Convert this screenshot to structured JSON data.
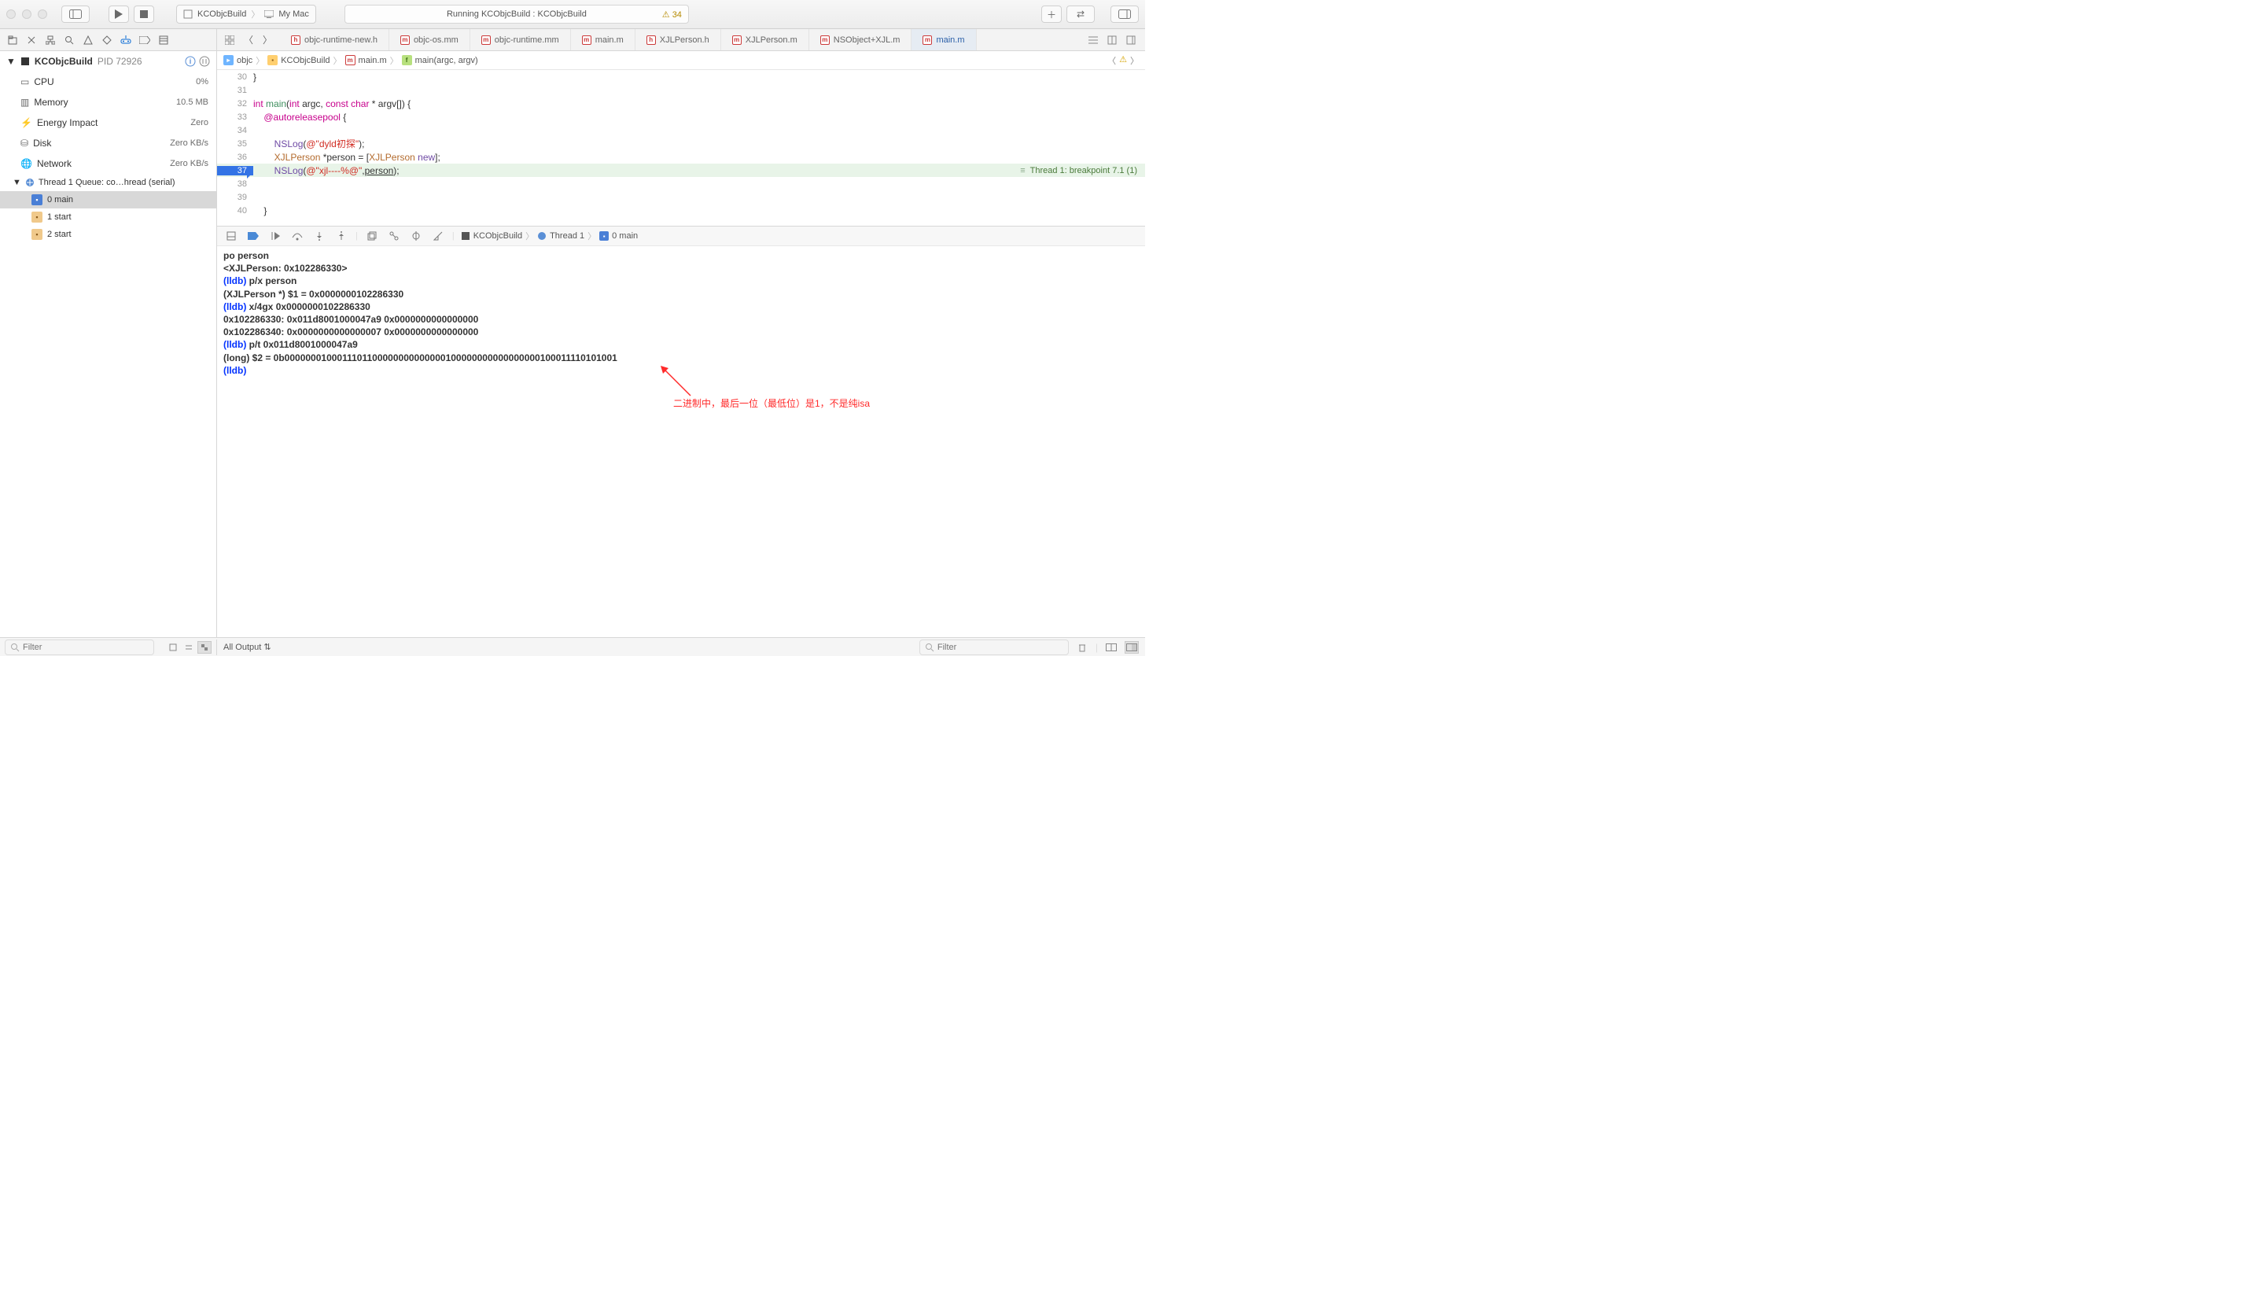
{
  "titlebar": {
    "scheme_project": "KCObjcBuild",
    "scheme_device": "My Mac",
    "activity_text": "Running KCObjcBuild : KCObjcBuild",
    "warning_count": "34"
  },
  "file_tabs": [
    {
      "icon": "h",
      "label": "objc-runtime-new.h"
    },
    {
      "icon": "m",
      "label": "objc-os.mm"
    },
    {
      "icon": "m",
      "label": "objc-runtime.mm"
    },
    {
      "icon": "m",
      "label": "main.m"
    },
    {
      "icon": "h",
      "label": "XJLPerson.h"
    },
    {
      "icon": "m",
      "label": "XJLPerson.m"
    },
    {
      "icon": "m",
      "label": "NSObject+XJL.m"
    },
    {
      "icon": "m",
      "label": "main.m",
      "active": true
    }
  ],
  "sidebar": {
    "process": "KCObjcBuild",
    "pid": "PID 72926",
    "stats": [
      {
        "icon": "cpu",
        "label": "CPU",
        "value": "0%"
      },
      {
        "icon": "mem",
        "label": "Memory",
        "value": "10.5 MB"
      },
      {
        "icon": "energy",
        "label": "Energy Impact",
        "value": "Zero"
      },
      {
        "icon": "disk",
        "label": "Disk",
        "value": "Zero KB/s"
      },
      {
        "icon": "net",
        "label": "Network",
        "value": "Zero KB/s"
      }
    ],
    "thread_label": "Thread 1 Queue: co…hread (serial)",
    "frames": [
      {
        "num": "0",
        "label": "main",
        "type": "user",
        "selected": true
      },
      {
        "num": "1",
        "label": "start",
        "type": "sys"
      },
      {
        "num": "2",
        "label": "start",
        "type": "sys"
      }
    ]
  },
  "jump_bar": {
    "root": "objc",
    "folder": "KCObjcBuild",
    "file": "main.m",
    "symbol": "main(argc, argv)"
  },
  "code": {
    "lines": [
      {
        "n": "30",
        "html": "}"
      },
      {
        "n": "31",
        "html": ""
      },
      {
        "n": "32",
        "html": "<span class='kw-pink'>int</span> <span class='kw-local'>main</span>(<span class='kw-pink'>int</span> argc, <span class='kw-pink'>const</span> <span class='kw-pink'>char</span> * argv[]) {"
      },
      {
        "n": "33",
        "html": "    <span class='kw-pink'>@autoreleasepool</span> {"
      },
      {
        "n": "34",
        "html": ""
      },
      {
        "n": "35",
        "html": "        <span class='kw-type'>NSLog</span>(<span class='kw-str'>@\"dyld初探\"</span>);"
      },
      {
        "n": "36",
        "html": "        <span class='kw-ann'>XJLPerson</span> *person = [<span class='kw-ann'>XJLPerson</span> <span class='kw-type'>new</span>];"
      },
      {
        "n": "37",
        "html": "        <span class='kw-type'>NSLog</span>(<span class='kw-str'>@\"xjl----%@\"</span>,<span class='kw-uline'>person</span>);",
        "current": true
      },
      {
        "n": "38",
        "html": ""
      },
      {
        "n": "39",
        "html": ""
      },
      {
        "n": "40",
        "html": "    }"
      }
    ],
    "breakpoint_msg": "Thread 1: breakpoint 7.1 (1)"
  },
  "console_lines": [
    {
      "t": "plain",
      "text": "po person"
    },
    {
      "t": "plain",
      "text": "<XJLPerson: 0x102286330>"
    },
    {
      "t": "plain",
      "text": ""
    },
    {
      "t": "lldb",
      "cmd": "p/x person"
    },
    {
      "t": "plain",
      "text": "(XJLPerson *) $1 = 0x0000000102286330"
    },
    {
      "t": "lldb",
      "cmd": "x/4gx 0x0000000102286330"
    },
    {
      "t": "plain",
      "text": "0x102286330: 0x011d8001000047a9 0x0000000000000000"
    },
    {
      "t": "plain",
      "text": "0x102286340: 0x0000000000000007 0x0000000000000000"
    },
    {
      "t": "lldb",
      "cmd": "p/t 0x011d8001000047a9"
    },
    {
      "t": "plain",
      "text": "(long) $2 = 0b0000000100011101100000000000000100000000000000000100011110101001"
    },
    {
      "t": "lldb",
      "cmd": ""
    }
  ],
  "dbg_crumb": {
    "project": "KCObjcBuild",
    "thread": "Thread 1",
    "frame": "0 main"
  },
  "annotation": "二进制中，最后一位（最低位）是1，不是纯isa",
  "bottom": {
    "filter_placeholder": "Filter",
    "output_scope": "All Output"
  }
}
